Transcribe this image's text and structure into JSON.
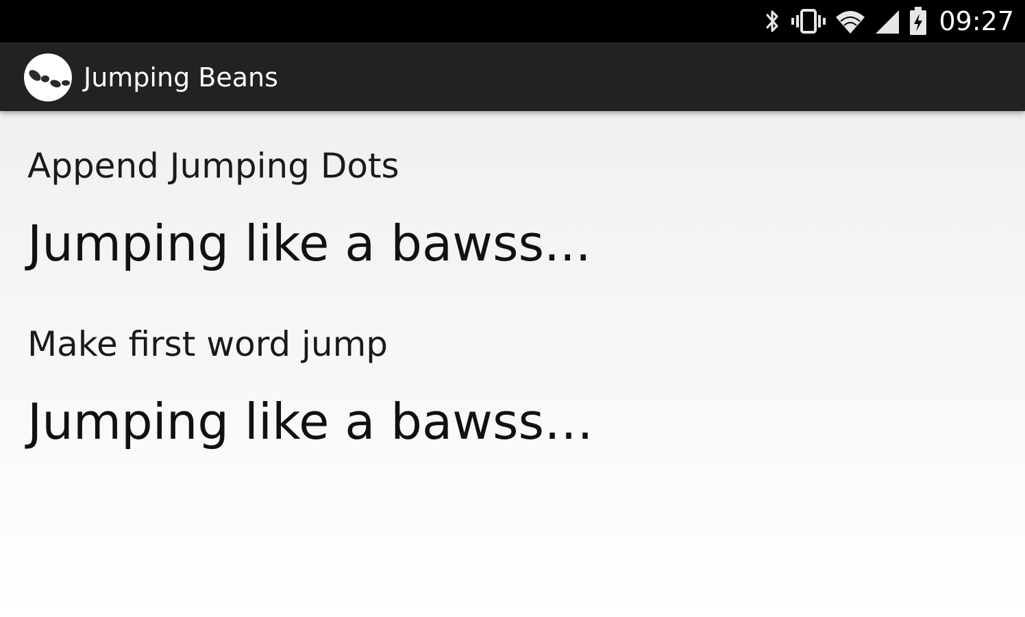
{
  "status_bar": {
    "time": "09:27",
    "icons": [
      "bluetooth-icon",
      "vibrate-icon",
      "wifi-icon",
      "signal-icon",
      "battery-charging-icon"
    ],
    "background": "#000000",
    "foreground": "#ffffff"
  },
  "action_bar": {
    "title": "Jumping Beans",
    "icon": "app-logo-icon",
    "background": "#222222"
  },
  "sections": [
    {
      "label": "Append Jumping Dots",
      "sample": "Jumping like a bawss..."
    },
    {
      "label": "Make first word jump",
      "sample": "Jumping like a bawss…"
    }
  ]
}
